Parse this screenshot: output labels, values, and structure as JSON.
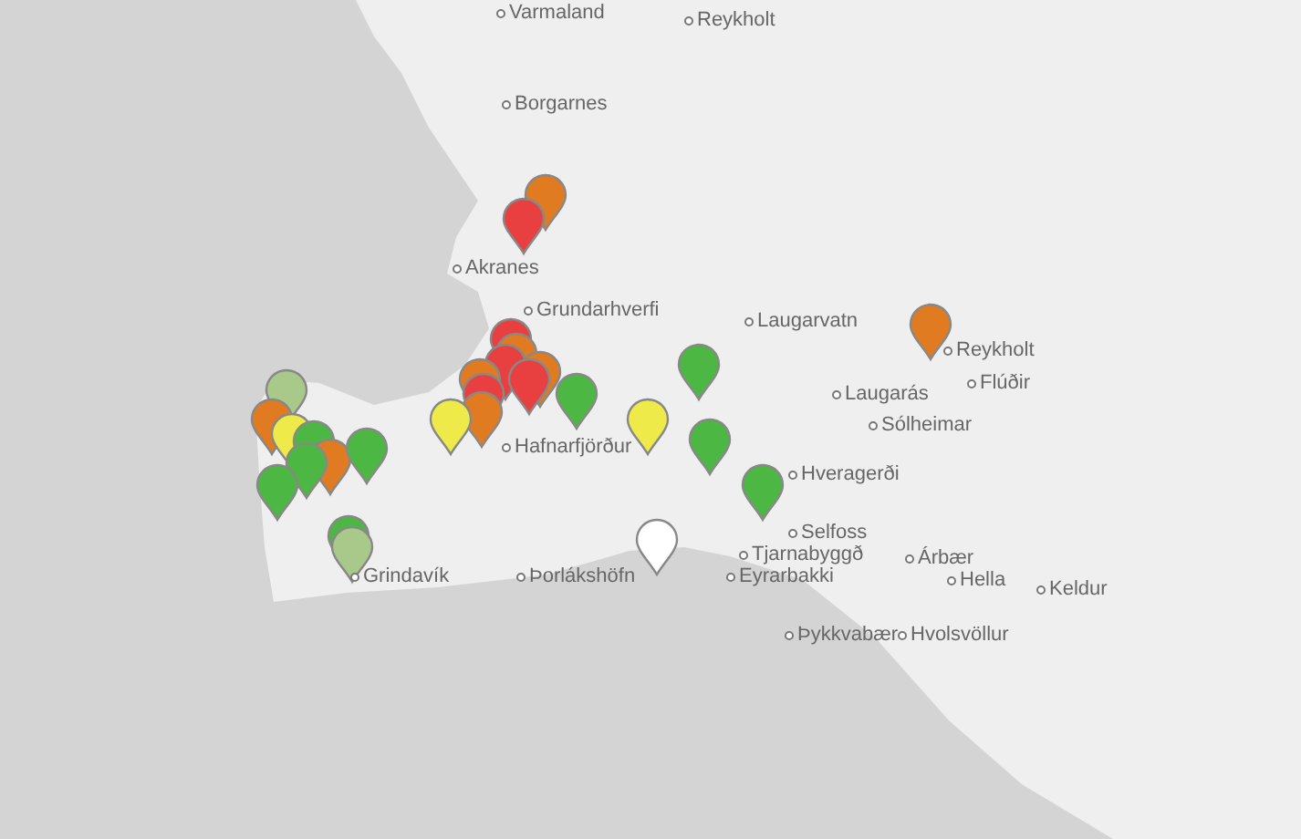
{
  "map": {
    "places": [
      {
        "name": "Varmaland"
      },
      {
        "name": "Reykholt"
      },
      {
        "name": "Borgarnes"
      },
      {
        "name": "Akranes"
      },
      {
        "name": "Grundarhverfi"
      },
      {
        "name": "Laugarvatn"
      },
      {
        "name": "Reykholt"
      },
      {
        "name": "Laugarás"
      },
      {
        "name": "Flúðir"
      },
      {
        "name": "Sólheimar"
      },
      {
        "name": "Hafnarfjörður"
      },
      {
        "name": "Hveragerði"
      },
      {
        "name": "Selfoss"
      },
      {
        "name": "Tjarnabyggð"
      },
      {
        "name": "Grindavík"
      },
      {
        "name": "Þorlákshöfn"
      },
      {
        "name": "Eyrarbakki"
      },
      {
        "name": "Árbær"
      },
      {
        "name": "Hella"
      },
      {
        "name": "Keldur"
      },
      {
        "name": "Þykkvabær"
      },
      {
        "name": "Hvolsvöllur"
      }
    ],
    "pins": [
      {
        "color": "#e07b22"
      },
      {
        "color": "#e84040"
      },
      {
        "color": "#e84040"
      },
      {
        "color": "#e07b22"
      },
      {
        "color": "#e84040"
      },
      {
        "color": "#e07b22"
      },
      {
        "color": "#e84040"
      },
      {
        "color": "#e07b22"
      },
      {
        "color": "#e84040"
      },
      {
        "color": "#e07b22"
      },
      {
        "color": "#eeea4a"
      },
      {
        "color": "#4cb843"
      },
      {
        "color": "#a8c98a"
      },
      {
        "color": "#e07b22"
      },
      {
        "color": "#eeea4a"
      },
      {
        "color": "#4cb843"
      },
      {
        "color": "#e07b22"
      },
      {
        "color": "#4cb843"
      },
      {
        "color": "#4cb843"
      },
      {
        "color": "#4cb843"
      },
      {
        "color": "#4cb843"
      },
      {
        "color": "#a8c98a"
      },
      {
        "color": "#4cb843"
      },
      {
        "color": "#eeea4a"
      },
      {
        "color": "#4cb843"
      },
      {
        "color": "#4cb843"
      },
      {
        "color": "#ffffff"
      },
      {
        "color": "#e07b22"
      }
    ]
  }
}
